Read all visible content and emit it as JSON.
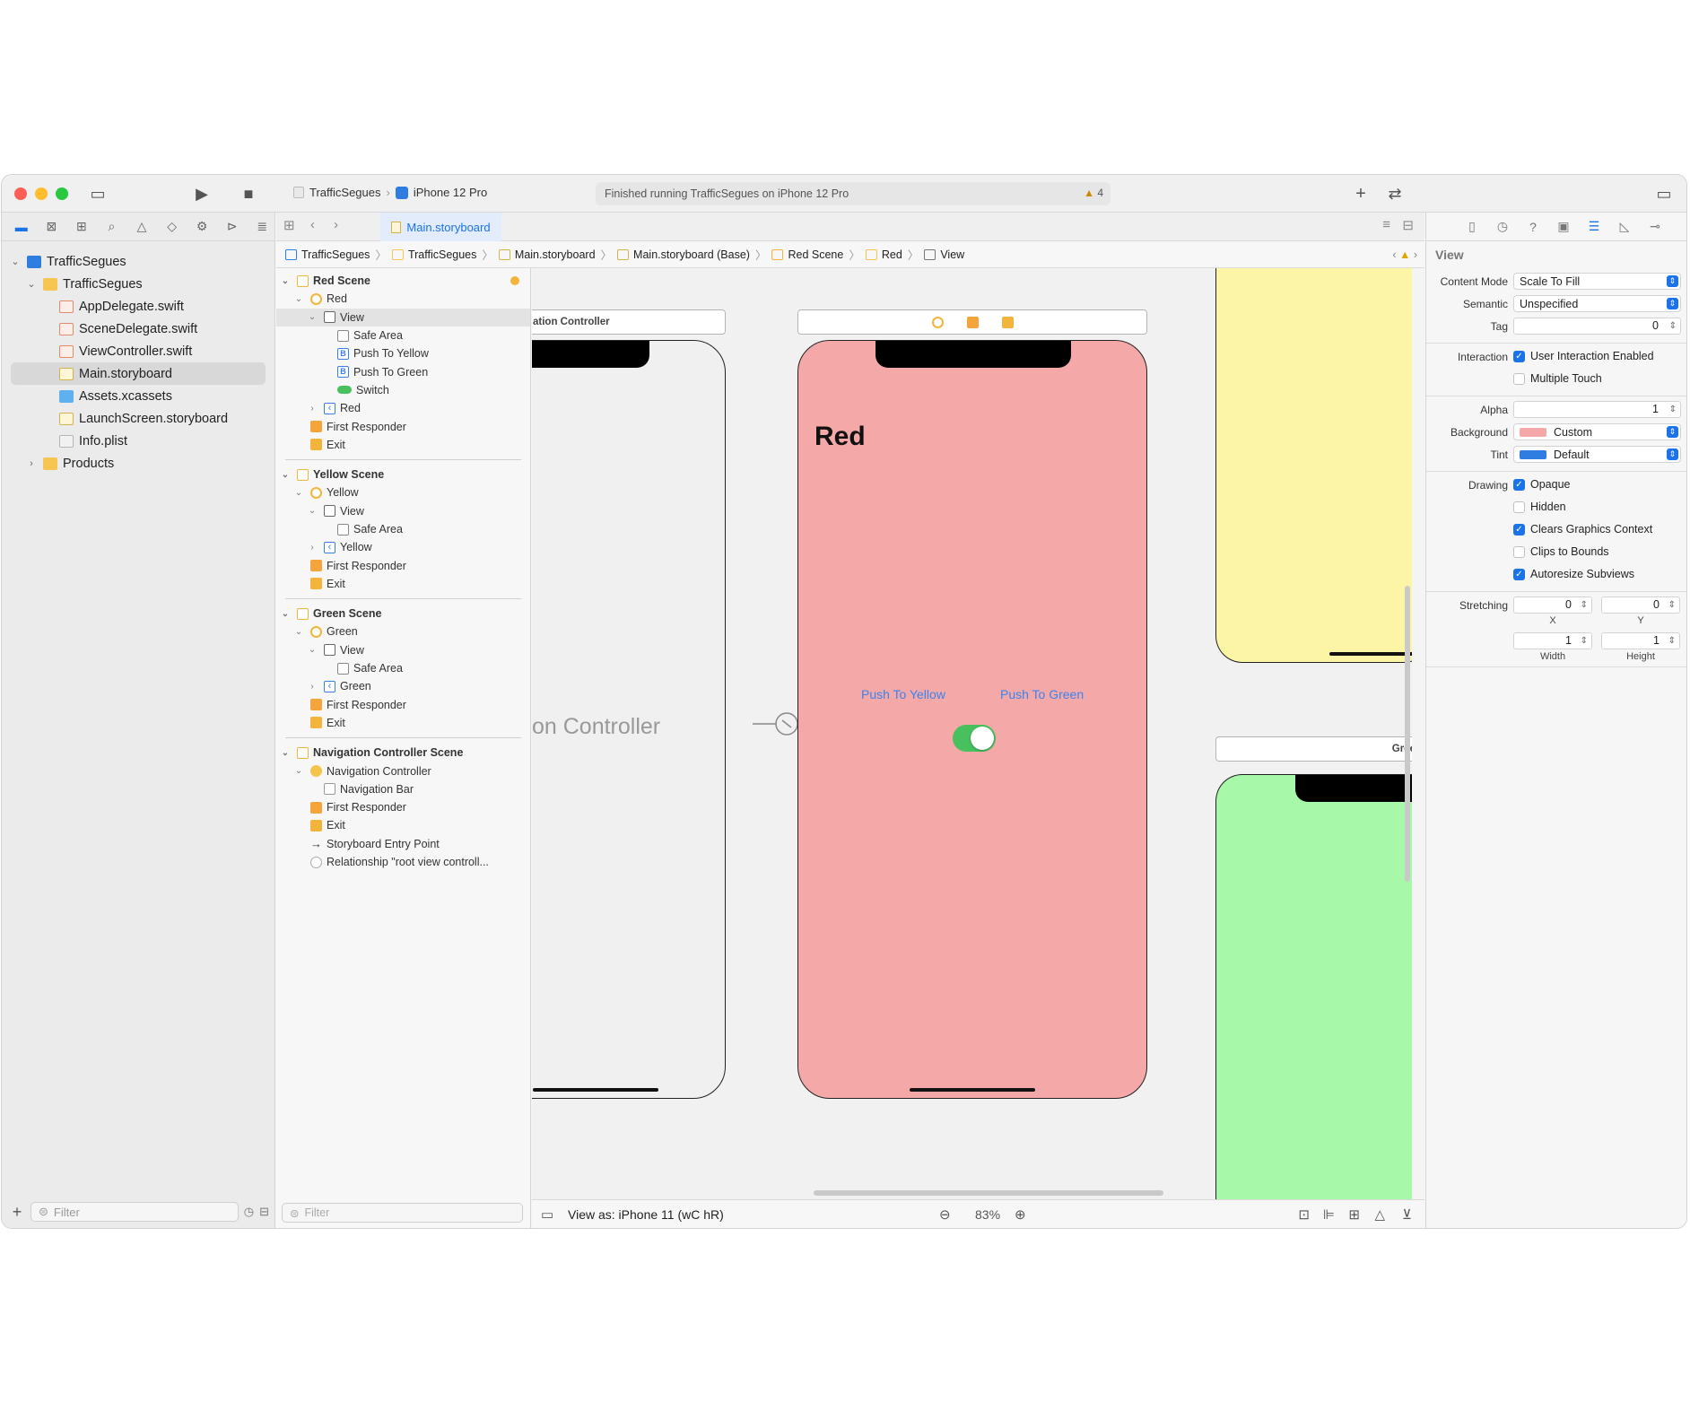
{
  "window": {
    "scheme_project": "TrafficSegues",
    "scheme_device": "iPhone 12 Pro",
    "status_text": "Finished running TrafficSegues on iPhone 12 Pro",
    "warning_count": "4"
  },
  "navigator": {
    "tree": [
      {
        "label": "TrafficSegues",
        "level": 0,
        "icon": "project-icon",
        "disclosure": "expanded"
      },
      {
        "label": "TrafficSegues",
        "level": 1,
        "icon": "folder-icon",
        "disclosure": "expanded"
      },
      {
        "label": "AppDelegate.swift",
        "level": 2,
        "icon": "swift-file-icon"
      },
      {
        "label": "SceneDelegate.swift",
        "level": 2,
        "icon": "swift-file-icon"
      },
      {
        "label": "ViewController.swift",
        "level": 2,
        "icon": "swift-file-icon"
      },
      {
        "label": "Main.storyboard",
        "level": 2,
        "icon": "storyboard-file-icon",
        "selected": true
      },
      {
        "label": "Assets.xcassets",
        "level": 2,
        "icon": "assets-icon"
      },
      {
        "label": "LaunchScreen.storyboard",
        "level": 2,
        "icon": "storyboard-file-icon"
      },
      {
        "label": "Info.plist",
        "level": 2,
        "icon": "plist-icon"
      },
      {
        "label": "Products",
        "level": 1,
        "icon": "folder-icon",
        "disclosure": "collapsed"
      }
    ],
    "filter_placeholder": "Filter"
  },
  "editor": {
    "open_tab": "Main.storyboard",
    "breadcrumb": [
      "TrafficSegues",
      "TrafficSegues",
      "Main.storyboard",
      "Main.storyboard (Base)",
      "Red Scene",
      "Red",
      "View"
    ],
    "outline": [
      {
        "label": "Red Scene",
        "level": 0,
        "type": "scene"
      },
      {
        "label": "Red",
        "level": 1,
        "type": "vc"
      },
      {
        "label": "View",
        "level": 2,
        "type": "view",
        "selected": true
      },
      {
        "label": "Safe Area",
        "level": 3,
        "type": "safe"
      },
      {
        "label": "Push To Yellow",
        "level": 3,
        "type": "btn"
      },
      {
        "label": "Push To Green",
        "level": 3,
        "type": "btn"
      },
      {
        "label": "Switch",
        "level": 3,
        "type": "switch"
      },
      {
        "label": "Red",
        "level": 2,
        "type": "nav"
      },
      {
        "label": "First Responder",
        "level": 1,
        "type": "fr"
      },
      {
        "label": "Exit",
        "level": 1,
        "type": "exit"
      },
      {
        "label": "Yellow Scene",
        "level": 0,
        "type": "scene"
      },
      {
        "label": "Yellow",
        "level": 1,
        "type": "vc"
      },
      {
        "label": "View",
        "level": 2,
        "type": "view"
      },
      {
        "label": "Safe Area",
        "level": 3,
        "type": "safe"
      },
      {
        "label": "Yellow",
        "level": 2,
        "type": "nav"
      },
      {
        "label": "First Responder",
        "level": 1,
        "type": "fr"
      },
      {
        "label": "Exit",
        "level": 1,
        "type": "exit"
      },
      {
        "label": "Green Scene",
        "level": 0,
        "type": "scene"
      },
      {
        "label": "Green",
        "level": 1,
        "type": "vc"
      },
      {
        "label": "View",
        "level": 2,
        "type": "view"
      },
      {
        "label": "Safe Area",
        "level": 3,
        "type": "safe"
      },
      {
        "label": "Green",
        "level": 2,
        "type": "nav"
      },
      {
        "label": "First Responder",
        "level": 1,
        "type": "fr"
      },
      {
        "label": "Exit",
        "level": 1,
        "type": "exit"
      },
      {
        "label": "Navigation Controller Scene",
        "level": 0,
        "type": "scene"
      },
      {
        "label": "Navigation Controller",
        "level": 1,
        "type": "navc"
      },
      {
        "label": "Navigation Bar",
        "level": 2,
        "type": "bar"
      },
      {
        "label": "First Responder",
        "level": 1,
        "type": "fr"
      },
      {
        "label": "Exit",
        "level": 1,
        "type": "exit"
      },
      {
        "label": "Storyboard Entry Point",
        "level": 1,
        "type": "entry"
      },
      {
        "label": "Relationship \"root view controll...",
        "level": 1,
        "type": "rel"
      }
    ],
    "outline_filter_placeholder": "Filter",
    "canvas": {
      "nav_scene_bar": "ation Controller",
      "nav_controller_label": "on Controller",
      "red_title": "Red",
      "push_yellow": "Push To Yellow",
      "push_green": "Push To Green",
      "switch_on": true,
      "green_scene_bar": "Green",
      "colors": {
        "red": "#f4a9a8",
        "yellow": "#fcf5a6",
        "green": "#a8f8a9"
      }
    },
    "bottom": {
      "view_as": "View as: iPhone 11 (",
      "view_as_suffix": "wC hR)",
      "zoom": "83%"
    }
  },
  "inspector": {
    "header": "View",
    "content_mode_label": "Content Mode",
    "content_mode": "Scale To Fill",
    "semantic_label": "Semantic",
    "semantic": "Unspecified",
    "tag_label": "Tag",
    "tag": "0",
    "interaction_label": "Interaction",
    "user_interaction": "User Interaction Enabled",
    "multiple_touch": "Multiple Touch",
    "alpha_label": "Alpha",
    "alpha": "1",
    "background_label": "Background",
    "background": "Custom",
    "background_color": "#f4a9a8",
    "tint_label": "Tint",
    "tint": "Default",
    "tint_color": "#2f7de1",
    "drawing_label": "Drawing",
    "opaque": "Opaque",
    "hidden": "Hidden",
    "clears_graphics": "Clears Graphics Context",
    "clips_bounds": "Clips to Bounds",
    "autoresize": "Autoresize Subviews",
    "stretching_label": "Stretching",
    "stretch_x": "0",
    "stretch_y": "0",
    "stretch_w": "1",
    "stretch_h": "1",
    "x_label": "X",
    "y_label": "Y",
    "width_label": "Width",
    "height_label": "Height"
  }
}
